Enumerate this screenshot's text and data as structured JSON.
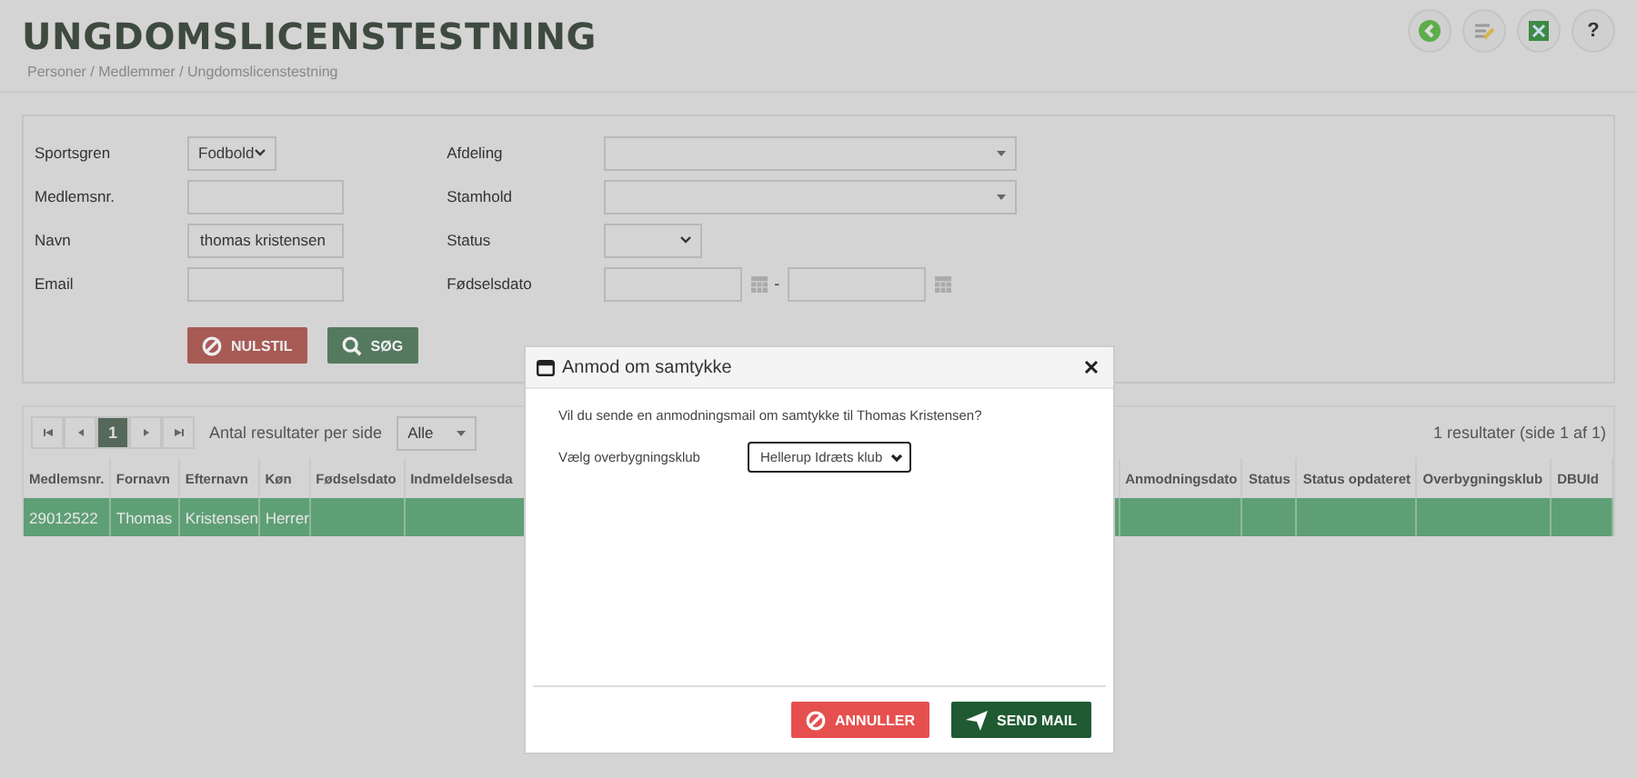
{
  "page": {
    "title": "UNGDOMSLICENSTESTNING",
    "help": "?",
    "breadcrumb": "Personer / Medlemmer / Ungdomslicenstestning"
  },
  "filters": {
    "left": [
      {
        "label": "Sportsgren",
        "kind": "select",
        "value": "Fodbold"
      },
      {
        "label": "Medlemsnr.",
        "kind": "text"
      },
      {
        "label": "Navn",
        "kind": "text",
        "value": "thomas kristensen"
      },
      {
        "label": "Email",
        "kind": "text"
      }
    ],
    "right": [
      {
        "label": "Afdeling",
        "kind": "wide-select"
      },
      {
        "label": "Stamhold",
        "kind": "wide-select"
      },
      {
        "label": "Status",
        "kind": "select"
      },
      {
        "label": "Fødselsdato",
        "kind": "daterange",
        "separator": "-"
      }
    ],
    "buttons": [
      {
        "label": "NULSTIL",
        "kind": "reset"
      },
      {
        "label": "SØG",
        "kind": "search"
      }
    ]
  },
  "pager": {
    "pages": [
      {
        "label": "1",
        "selected": true
      }
    ],
    "per_page_label": "Antal resultater per side",
    "per_page": "Alle",
    "summary": "1 resultater (side 1 af 1)"
  },
  "table": {
    "columns": [
      "Medlemsnr.",
      "Fornavn",
      "Efternavn",
      "Køn",
      "Fødselsdato",
      "Indmeldelsesda",
      "Anmodningsdato",
      "Status",
      "Status opdateret",
      "Overbygningsklub",
      "DBUId"
    ],
    "rows": [
      {
        "selected": true,
        "cells": [
          "29012522",
          "Thomas",
          "Kristensen",
          "Herrer",
          "",
          "",
          "",
          "",
          "",
          "",
          ""
        ]
      }
    ]
  },
  "dialog": {
    "title": "Anmod om samtykke",
    "message": "Vil du sende en anmodningsmail om samtykke til Thomas Kristensen?",
    "field_label": "Vælg overbygningsklub",
    "field_value": "Hellerup Idræts klub",
    "buttons": [
      {
        "label": "ANNULLER",
        "kind": "cancel"
      },
      {
        "label": "SEND MAIL",
        "kind": "send"
      }
    ]
  }
}
